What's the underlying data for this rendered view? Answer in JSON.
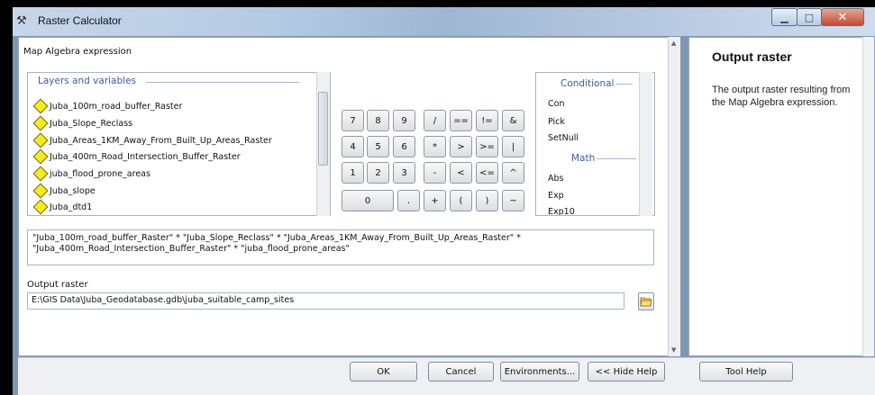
{
  "window": {
    "title": "Raster Calculator"
  },
  "calculator": {
    "map_algebra_label": "Map Algebra expression",
    "layers_header": "Layers and variables",
    "layers": [
      "Juba_100m_road_buffer_Raster",
      "Juba_Slope_Reclass",
      "Juba_Areas_1KM_Away_From_Built_Up_Areas_Raster",
      "Juba_400m_Road_Intersection_Buffer_Raster",
      "juba_flood_prone_areas",
      "Juba_slope",
      "Juba_dtd1"
    ],
    "keypad": {
      "row1": [
        "7",
        "8",
        "9",
        "/",
        "==",
        "!=",
        "&"
      ],
      "row2": [
        "4",
        "5",
        "6",
        "*",
        ">",
        ">=",
        "|"
      ],
      "row3": [
        "1",
        "2",
        "3",
        "-",
        "<",
        "<=",
        "^"
      ],
      "row4": [
        "0",
        ".",
        "+",
        "(",
        ")",
        "~"
      ]
    },
    "functions": {
      "conditional_header": "Conditional",
      "conditional": [
        "Con",
        "Pick",
        "SetNull"
      ],
      "math_header": "Math",
      "math": [
        "Abs",
        "Exp",
        "Exp10"
      ]
    },
    "expression": "\"Juba_100m_road_buffer_Raster\" * \"Juba_Slope_Reclass\" * \"Juba_Areas_1KM_Away_From_Built_Up_Areas_Raster\" *\n\"Juba_400m_Road_Intersection_Buffer_Raster\" * \"juba_flood_prone_areas\"",
    "output_label": "Output raster",
    "output_value": "E:\\GIS Data\\Juba_Geodatabase.gdb\\juba_suitable_camp_sites"
  },
  "help": {
    "title": "Output raster",
    "text": "The output raster resulting from the Map Algebra expression."
  },
  "buttons": {
    "ok": "OK",
    "cancel": "Cancel",
    "environments": "Environments...",
    "hide_help": "<< Hide Help",
    "tool_help": "Tool Help"
  },
  "icons": [
    "tool-icon",
    "minimize-icon",
    "maximize-icon",
    "close-icon",
    "folder-open-icon",
    "layer-diamond-icon"
  ]
}
